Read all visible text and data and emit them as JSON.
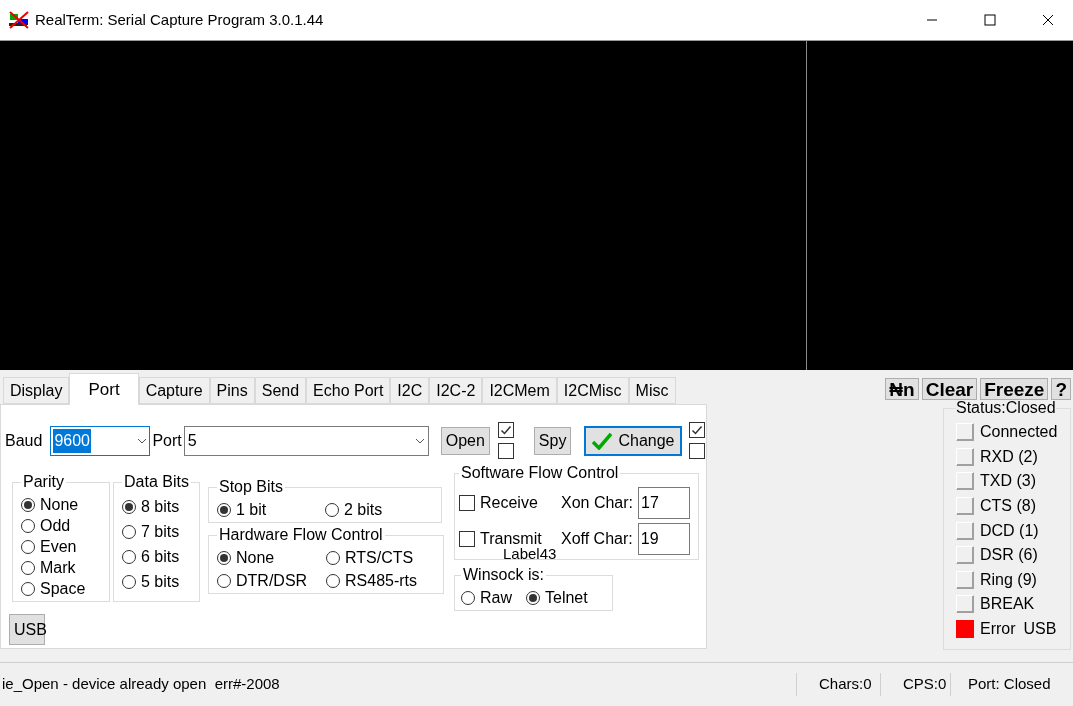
{
  "window": {
    "title": "RealTerm: Serial Capture Program 3.0.1.44"
  },
  "tabs": [
    {
      "label": "Display",
      "selected": false
    },
    {
      "label": "Port",
      "selected": true
    },
    {
      "label": "Capture",
      "selected": false
    },
    {
      "label": "Pins",
      "selected": false
    },
    {
      "label": "Send",
      "selected": false
    },
    {
      "label": "Echo Port",
      "selected": false
    },
    {
      "label": "I2C",
      "selected": false
    },
    {
      "label": "I2C-2",
      "selected": false
    },
    {
      "label": "I2CMem",
      "selected": false
    },
    {
      "label": "I2CMisc",
      "selected": false
    },
    {
      "label": "Misc",
      "selected": false
    }
  ],
  "toolbar_buttons": [
    "₦n",
    "Clear",
    "Freeze",
    "?"
  ],
  "baud": {
    "label": "Baud",
    "value": "9600"
  },
  "port": {
    "label": "Port",
    "value": "5"
  },
  "open_button": {
    "label": "Open",
    "checkboxes": [
      {
        "checked": true
      },
      {
        "checked": false
      }
    ]
  },
  "spy_button": {
    "label": "Spy"
  },
  "change_button": {
    "label": "Change",
    "checkboxes": [
      {
        "checked": true
      },
      {
        "checked": false
      }
    ]
  },
  "parity": {
    "title": "Parity",
    "options": [
      {
        "label": "None",
        "selected": true
      },
      {
        "label": "Odd",
        "selected": false
      },
      {
        "label": "Even",
        "selected": false
      },
      {
        "label": "Mark",
        "selected": false
      },
      {
        "label": "Space",
        "selected": false
      }
    ]
  },
  "data_bits": {
    "title": "Data Bits",
    "options": [
      {
        "label": "8 bits",
        "selected": true
      },
      {
        "label": "7 bits",
        "selected": false
      },
      {
        "label": "6 bits",
        "selected": false
      },
      {
        "label": "5 bits",
        "selected": false
      }
    ]
  },
  "stop_bits": {
    "title": "Stop Bits",
    "options": [
      {
        "label": "1 bit",
        "selected": true
      },
      {
        "label": "2 bits",
        "selected": false
      }
    ]
  },
  "hardware_flow": {
    "title": "Hardware Flow Control",
    "options": [
      {
        "label": "None",
        "selected": true
      },
      {
        "label": "RTS/CTS",
        "selected": false
      },
      {
        "label": "DTR/DSR",
        "selected": false
      },
      {
        "label": "RS485-rts",
        "selected": false
      }
    ]
  },
  "software_flow": {
    "title": "Software Flow Control",
    "rows": [
      {
        "label": "Receive",
        "checked": false,
        "char_label": "Xon Char:",
        "char_value": "17"
      },
      {
        "label": "Transmit",
        "checked": false,
        "char_label": "Xoff Char:",
        "char_value": "19"
      }
    ],
    "overlay_label": "Label43"
  },
  "winsock": {
    "title": "Winsock is:",
    "options": [
      {
        "label": "Raw",
        "selected": false
      },
      {
        "label": "Telnet",
        "selected": true
      }
    ]
  },
  "usb_button": "USB",
  "status": {
    "title": "Status:Closed",
    "indicators": [
      {
        "label": "Connected",
        "on": false
      },
      {
        "label": "RXD (2)",
        "on": false
      },
      {
        "label": "TXD (3)",
        "on": false
      },
      {
        "label": "CTS (8)",
        "on": false
      },
      {
        "label": "DCD (1)",
        "on": false
      },
      {
        "label": "DSR (6)",
        "on": false
      },
      {
        "label": "Ring (9)",
        "on": false
      },
      {
        "label": "BREAK",
        "on": false
      },
      {
        "label": "Error",
        "on": true
      }
    ],
    "extra": "USB"
  },
  "status_bar": {
    "message": "ie_Open - device already open  err#-2008",
    "chars": "Chars:0",
    "cps": "CPS:0",
    "port": "Port: Closed"
  }
}
